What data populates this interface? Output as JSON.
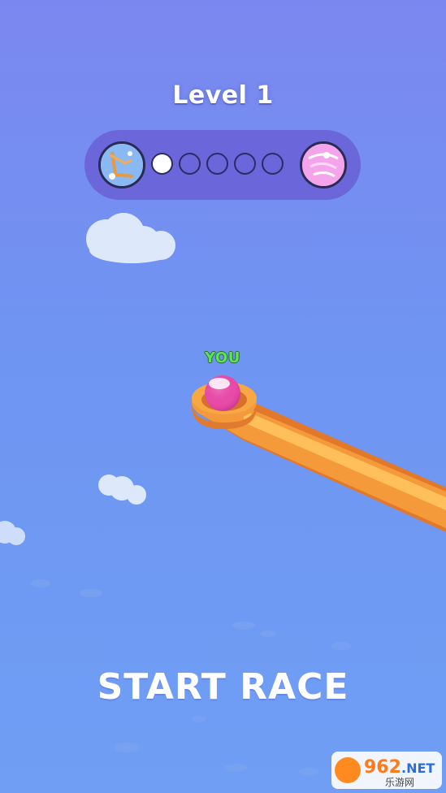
{
  "hud": {
    "level_title": "Level 1",
    "progress": {
      "total_stages": 5,
      "completed_stages": 1,
      "start_icon": "wooden-track-level-icon",
      "end_icon": "pink-track-level-icon"
    }
  },
  "player": {
    "label": "YOU",
    "ball_color": "#e84aa8",
    "label_color": "#5de35a"
  },
  "track": {
    "color": "#f7a23c"
  },
  "cta": {
    "start_label": "START RACE"
  },
  "watermark": {
    "brand": "962.NET",
    "sub": "乐游网"
  }
}
